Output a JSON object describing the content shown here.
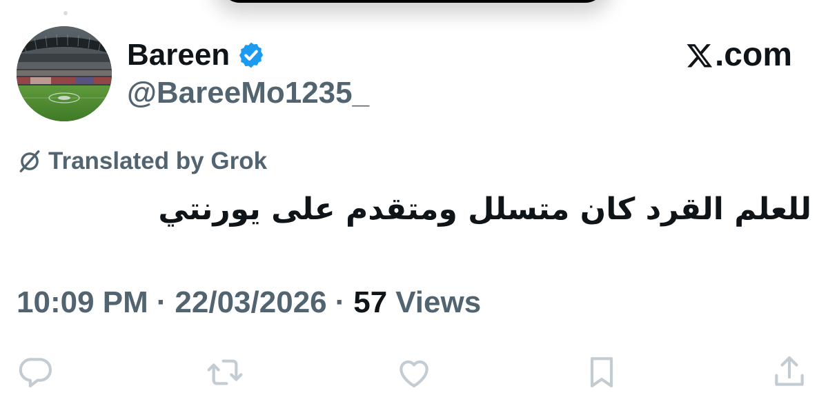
{
  "author": {
    "display_name": "Bareen",
    "handle": "@BareeMo1235_",
    "verified_icon": "verified-badge-icon"
  },
  "brand": {
    "logo_icon": "x-logo-icon",
    "text": ".com"
  },
  "translation": {
    "label": "Translated by Grok",
    "icon": "translate-slash-icon"
  },
  "tweet": {
    "text": "للعلم القرد كان متسلل ومتقدم على يورنتي"
  },
  "meta": {
    "time": "10:09 PM",
    "separator": "·",
    "date": "22/03/2026",
    "views_count": "57",
    "views_label": "Views"
  },
  "actions": [
    {
      "name": "reply-icon"
    },
    {
      "name": "retweet-icon"
    },
    {
      "name": "like-icon"
    },
    {
      "name": "bookmark-icon"
    },
    {
      "name": "share-icon"
    }
  ],
  "colors": {
    "primary_text": "#0f1419",
    "secondary_text": "#536471",
    "verified_blue": "#1d9bf0",
    "action_icons": "#c4ccd3"
  }
}
